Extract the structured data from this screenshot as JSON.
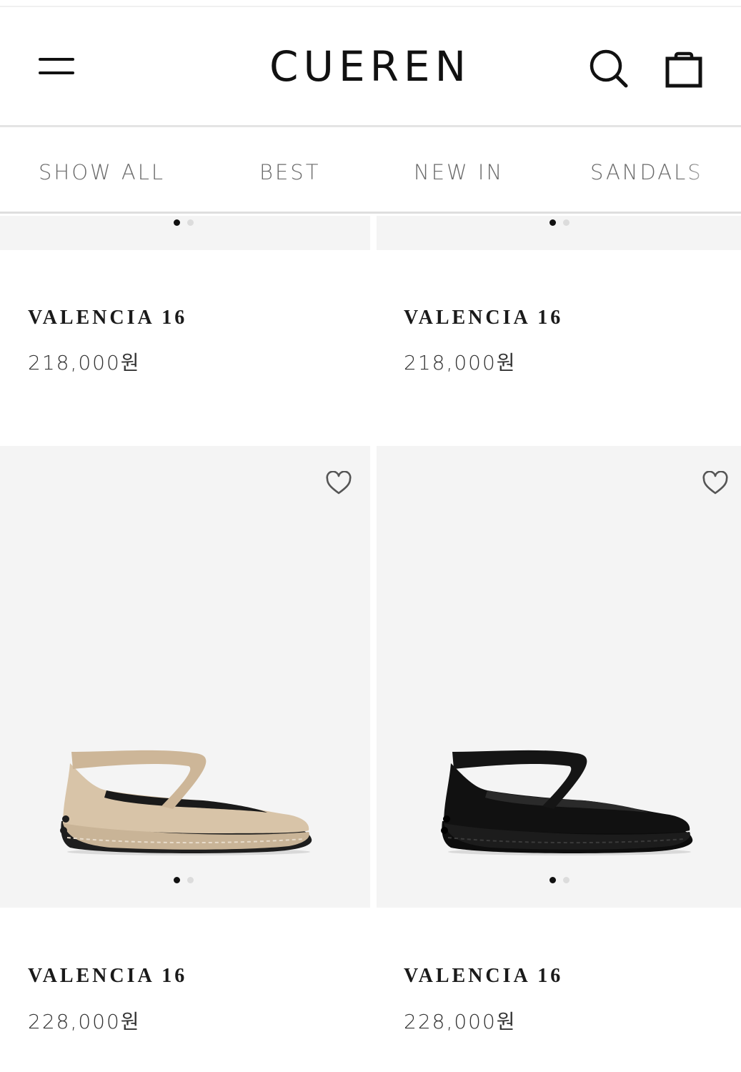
{
  "header": {
    "logo": "CUEREN",
    "menu_icon": "hamburger-menu-icon",
    "search_icon": "search-icon",
    "bag_icon": "shopping-bag-icon"
  },
  "tabs": [
    {
      "label": "SHOW ALL"
    },
    {
      "label": "BEST"
    },
    {
      "label": "NEW IN"
    },
    {
      "label": "SANDALS"
    }
  ],
  "products": [
    {
      "name": "VALENCIA 16",
      "price": "218,000원"
    },
    {
      "name": "VALENCIA 16",
      "price": "218,000원"
    },
    {
      "name": "VALENCIA 16",
      "price": "228,000원",
      "color": "#d8c4a8"
    },
    {
      "name": "VALENCIA 16",
      "price": "228,000원",
      "color": "#111111"
    }
  ],
  "colors": {
    "image_background": "#f4f4f4",
    "active_dot": "#111111",
    "inactive_dot": "#dcdcdc"
  }
}
